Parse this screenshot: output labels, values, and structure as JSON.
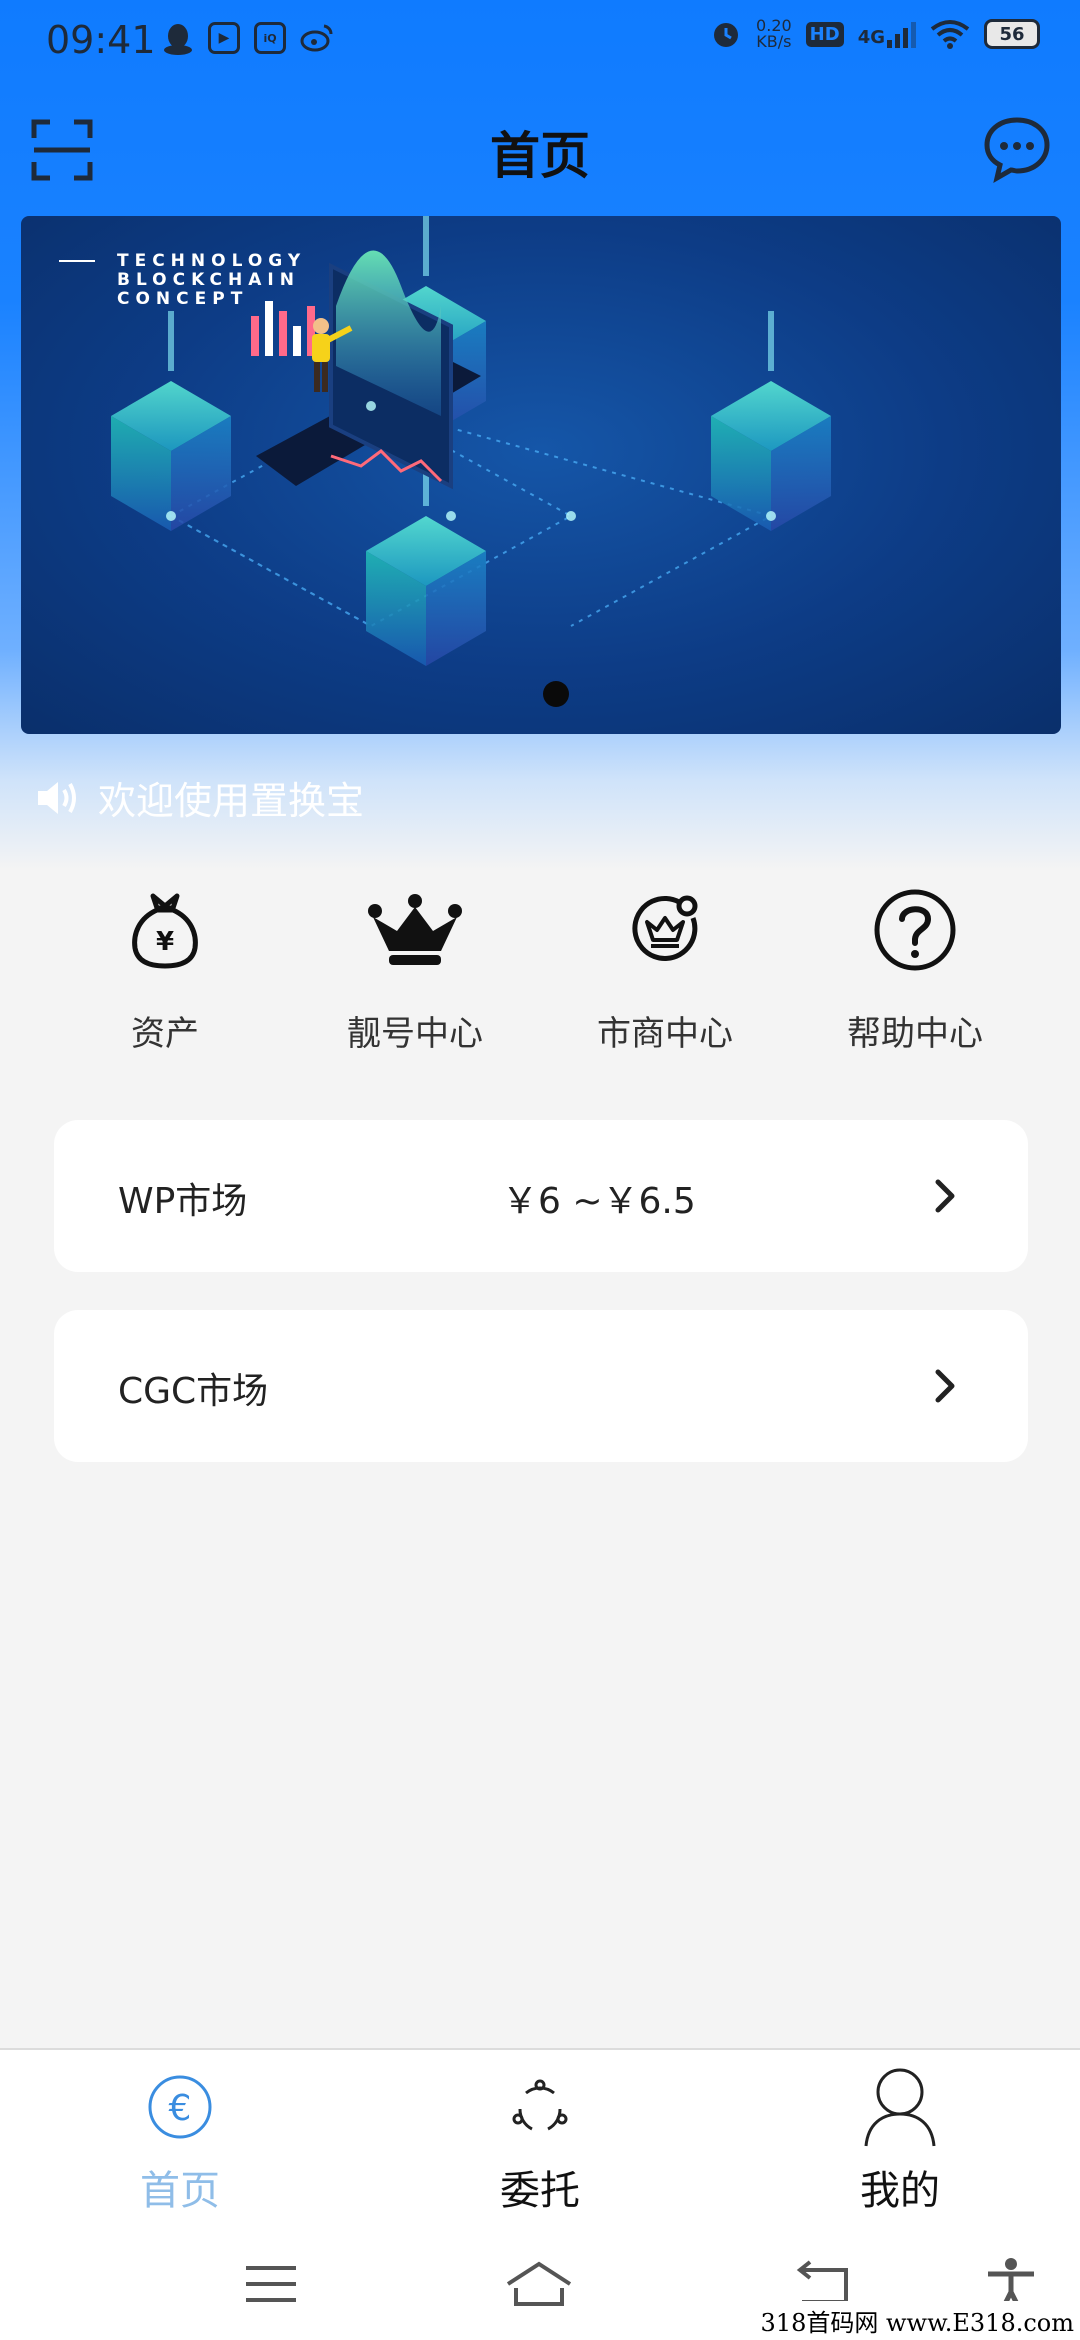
{
  "status_bar": {
    "time": "09:41",
    "net_speed_value": "0.20",
    "net_speed_unit": "KB/s",
    "hd_label": "HD",
    "network_label": "4G",
    "battery_level": "56"
  },
  "header": {
    "title": "首页"
  },
  "banner": {
    "label_line1": "TECHNOLOGY",
    "label_line2": "BLOCKCHAIN",
    "label_line3": "CONCEPT"
  },
  "notice": {
    "text": "欢迎使用置换宝"
  },
  "quick_menu": [
    {
      "label": "资产",
      "icon": "money-bag-icon"
    },
    {
      "label": "靓号中心",
      "icon": "crown-icon"
    },
    {
      "label": "市商中心",
      "icon": "crown-badge-icon"
    },
    {
      "label": "帮助中心",
      "icon": "help-icon"
    }
  ],
  "markets": [
    {
      "name": "WP市场",
      "price": "￥6 ~￥6.5"
    },
    {
      "name": "CGC市场",
      "price": ""
    }
  ],
  "tab_bar": [
    {
      "label": "首页",
      "icon": "euro-icon",
      "active": true
    },
    {
      "label": "委托",
      "icon": "share-circle-icon",
      "active": false
    },
    {
      "label": "我的",
      "icon": "user-icon",
      "active": false
    }
  ],
  "watermark": "318首码网 www.E318.com",
  "colors": {
    "primary": "#1a82ff",
    "active_tab": "#8fbde8",
    "background": "#f4f4f4"
  }
}
